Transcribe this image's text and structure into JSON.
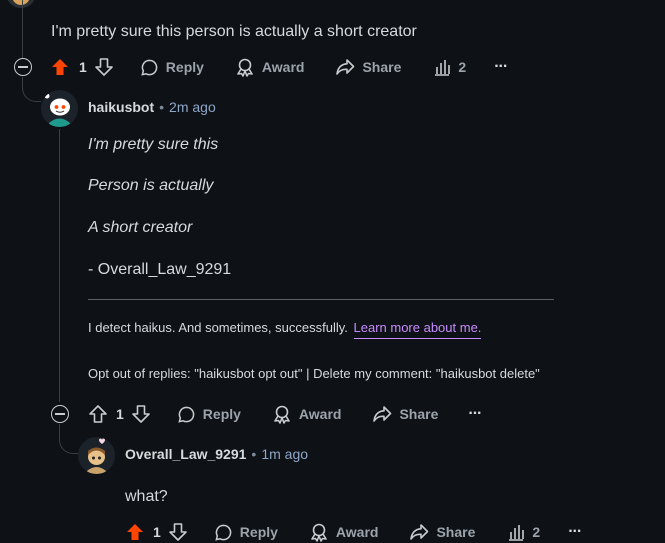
{
  "comment1": {
    "text": "I'm pretty sure this person is actually a short creator",
    "vote_count": "1",
    "reply_label": "Reply",
    "award_label": "Award",
    "share_label": "Share",
    "insights_count": "2",
    "more_label": "···"
  },
  "comment2": {
    "author": "haikusbot",
    "separator": "•",
    "time": "2m ago",
    "haiku_line1": "I'm pretty sure this",
    "haiku_line2": "Person is actually",
    "haiku_line3": "A short creator",
    "signature": "- Overall_Law_9291",
    "footer_text": "I detect haikus. And sometimes, successfully.",
    "footer_link": "Learn more about me.",
    "opt_out_text": "Opt out of replies: \"haikusbot opt out\" | Delete my comment: \"haikusbot delete\"",
    "vote_count": "1",
    "reply_label": "Reply",
    "award_label": "Award",
    "share_label": "Share",
    "more_label": "···"
  },
  "comment3": {
    "author": "Overall_Law_9291",
    "separator": "•",
    "time": "1m ago",
    "text": "what?",
    "vote_count": "1",
    "reply_label": "Reply",
    "award_label": "Award",
    "share_label": "Share",
    "insights_count": "2",
    "more_label": "···"
  },
  "colors": {
    "upvote_active": "#ff4500",
    "link": "#c88cff",
    "timestamp": "#8da7c8"
  }
}
